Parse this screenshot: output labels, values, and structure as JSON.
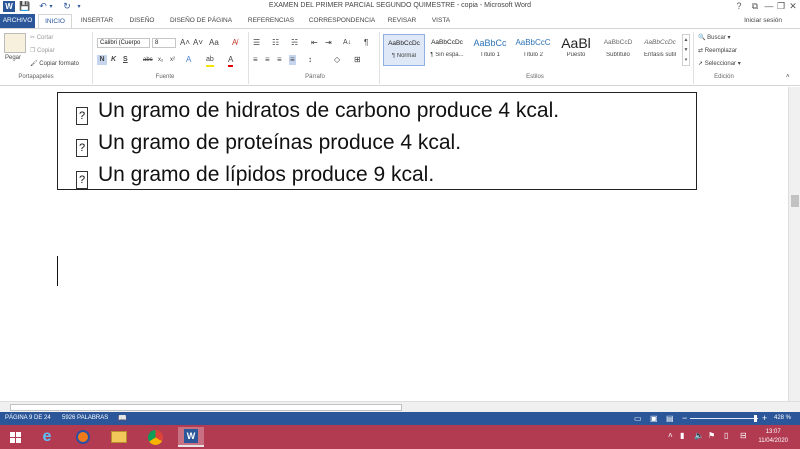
{
  "window": {
    "title": "EXAMEN DEL PRIMER PARCIAL SEGUNDO QUIMESTRE - copia - Microsoft Word",
    "app_icon": "W",
    "controls": {
      "help": "?",
      "ribbon_options": "⧉",
      "minimize": "—",
      "restore": "❐",
      "close": "✕"
    }
  },
  "quick_access": {
    "save": "💾",
    "undo": "↶",
    "undo_dropdown": "▾",
    "redo": "↻",
    "customize": "▾"
  },
  "tabs": [
    "ARCHIVO",
    "INICIO",
    "INSERTAR",
    "DISEÑO",
    "DISEÑO DE PÁGINA",
    "REFERENCIAS",
    "CORRESPONDENCIA",
    "REVISAR",
    "VISTA"
  ],
  "account": {
    "signin": "Iniciar sesión"
  },
  "ribbon": {
    "clipboard": {
      "label": "Portapapeles",
      "paste": "Pegar",
      "cut": "Cortar",
      "copy": "Copiar",
      "format_painter": "Copiar formato"
    },
    "font": {
      "label": "Fuente",
      "family": "Calibri (Cuerpo",
      "size": "8",
      "grow": "A˄",
      "shrink": "A˅",
      "case": "Aa",
      "clear": "A̸",
      "bold": "N",
      "italic": "K",
      "underline": "S",
      "strike": "abc",
      "subscript": "x₂",
      "superscript": "x²",
      "effects": "A",
      "highlight": "ab",
      "color": "A"
    },
    "paragraph": {
      "label": "Párrafo",
      "bullets": "☰",
      "numbering": "☷",
      "multilevel": "☵",
      "decrease_indent": "⇤",
      "increase_indent": "⇥",
      "sort": "A↓",
      "show_marks": "¶",
      "align_left": "≡",
      "align_center": "≡",
      "align_right": "≡",
      "justify": "≡",
      "line_spacing": "↕",
      "shading": "◇",
      "borders": "⊞"
    },
    "styles": {
      "label": "Estilos",
      "items": [
        {
          "preview": "AaBbCcDc",
          "name": "¶ Normal"
        },
        {
          "preview": "AaBbCcDc",
          "name": "¶ Sin espa..."
        },
        {
          "preview": "AaBbCc",
          "name": "Título 1"
        },
        {
          "preview": "AaBbCcC",
          "name": "Título 2"
        },
        {
          "preview": "AaBl",
          "name": "Puesto"
        },
        {
          "preview": "AaBbCcD",
          "name": "Subtítulo"
        },
        {
          "preview": "AaBbCcDc",
          "name": "Énfasis sutil"
        }
      ]
    },
    "editing": {
      "label": "Edición",
      "find": "Buscar",
      "replace": "Reemplazar",
      "select": "Seleccionar"
    }
  },
  "document": {
    "lines": [
      "Un gramo de hidratos de carbono produce 4 kcal.",
      "Un gramo de proteínas produce 4 kcal.",
      "Un gramo de lípidos produce 9 kcal."
    ],
    "bullet_glyph": "?"
  },
  "status": {
    "page": "PÁGINA 9 DE 24",
    "words": "5926 PALABRAS",
    "zoom": "428 %",
    "zoom_out": "−",
    "zoom_in": "+"
  },
  "taskbar": {
    "time": "13:07",
    "date": "11/04/2020"
  },
  "colors": {
    "accent": "#2b579a",
    "taskbar": "#b23b52"
  }
}
